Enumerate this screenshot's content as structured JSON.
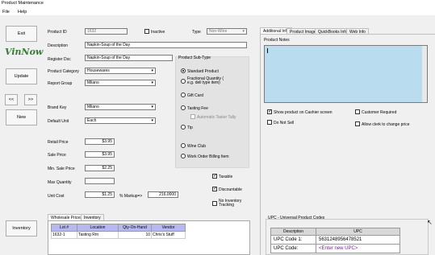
{
  "window": {
    "title": "Product Maintenance"
  },
  "menu": {
    "file": "File",
    "help": "Help"
  },
  "left_buttons": {
    "exit": "Exit",
    "update": "Update",
    "prev": "<<",
    "next": ">>",
    "new": "New",
    "inventory": "Inventory"
  },
  "logo": {
    "text": "VinNow"
  },
  "form": {
    "product_id_label": "Product ID",
    "product_id": "1632",
    "inactive_label": "Inactive",
    "type_label": "Type",
    "type_value": "Non-Wine",
    "description_label": "Description",
    "description": "Napkin-Soup of the Day",
    "register_desc_label": "Register Dsc",
    "register_desc": "Napkin-Soup of the Day",
    "category_label": "Product Category",
    "category": "Housewares",
    "report_group_label": "Report Group",
    "report_group": "Milano",
    "brand_key_label": "Brand Key",
    "brand_key": "Milano",
    "default_unit_label": "Default Unit",
    "default_unit": "Each",
    "retail_price_label": "Retail Price",
    "retail_price": "$3.95",
    "sale_price_label": "Sale Price",
    "sale_price": "$3.95",
    "min_sale_price_label": "Min. Sale Price",
    "min_sale_price": "$2.25",
    "max_quantity_label": "Max Quantity",
    "max_quantity": "",
    "unit_cost_label": "Unit Cost",
    "unit_cost": "$1.25",
    "markup_label": "% Markup=>",
    "markup": "216.0000",
    "taxable_label": "Taxable",
    "discountable_label": "Discountable",
    "no_inventory_label": "No Inventory Tracking"
  },
  "subtype": {
    "title": "Product Sub-Type",
    "options": [
      "Standard Product",
      "Fractional Quantity ( e.g. deli type item)",
      "Gift Card",
      "Tasting Fee",
      "Tip",
      "Wine Club",
      "Work Order Billing Item"
    ],
    "auto_taster_tally": "Automatic Taster Tally"
  },
  "bottom_tabs": [
    "Wholesale Prices",
    "Inventory"
  ],
  "inventory_grid": {
    "headers": [
      "Lot #",
      "Location",
      "Qty-On-Hand",
      "Vendor"
    ],
    "rows": [
      [
        "1632-1",
        "Tasting Rm",
        "10",
        "Chris's Stuff"
      ]
    ]
  },
  "right_tabs": [
    "Additional Info",
    "Product Image",
    "QuickBooks Info",
    "Web Info"
  ],
  "right": {
    "product_notes_label": "Product Notes",
    "show_cashier_label": "Show product on Cashier screen",
    "customer_required_label": "Customer Required",
    "do_not_sell_label": "Do Not Sell",
    "allow_clerk_label": "Allow clerk to change price",
    "upc_section_label": "UPC - Universal Product Codes",
    "upc_headers": [
      "Description",
      "UPC"
    ],
    "upc_rows": [
      [
        "UPC Code 1:",
        "5631248956478521"
      ],
      [
        "UPC Code:",
        "<Enter new UPC>"
      ]
    ]
  },
  "colors": {
    "notes_bg": "#b9dcef",
    "grid_header": "#b8b8f0",
    "enter_upc": "#7a1fa2"
  }
}
